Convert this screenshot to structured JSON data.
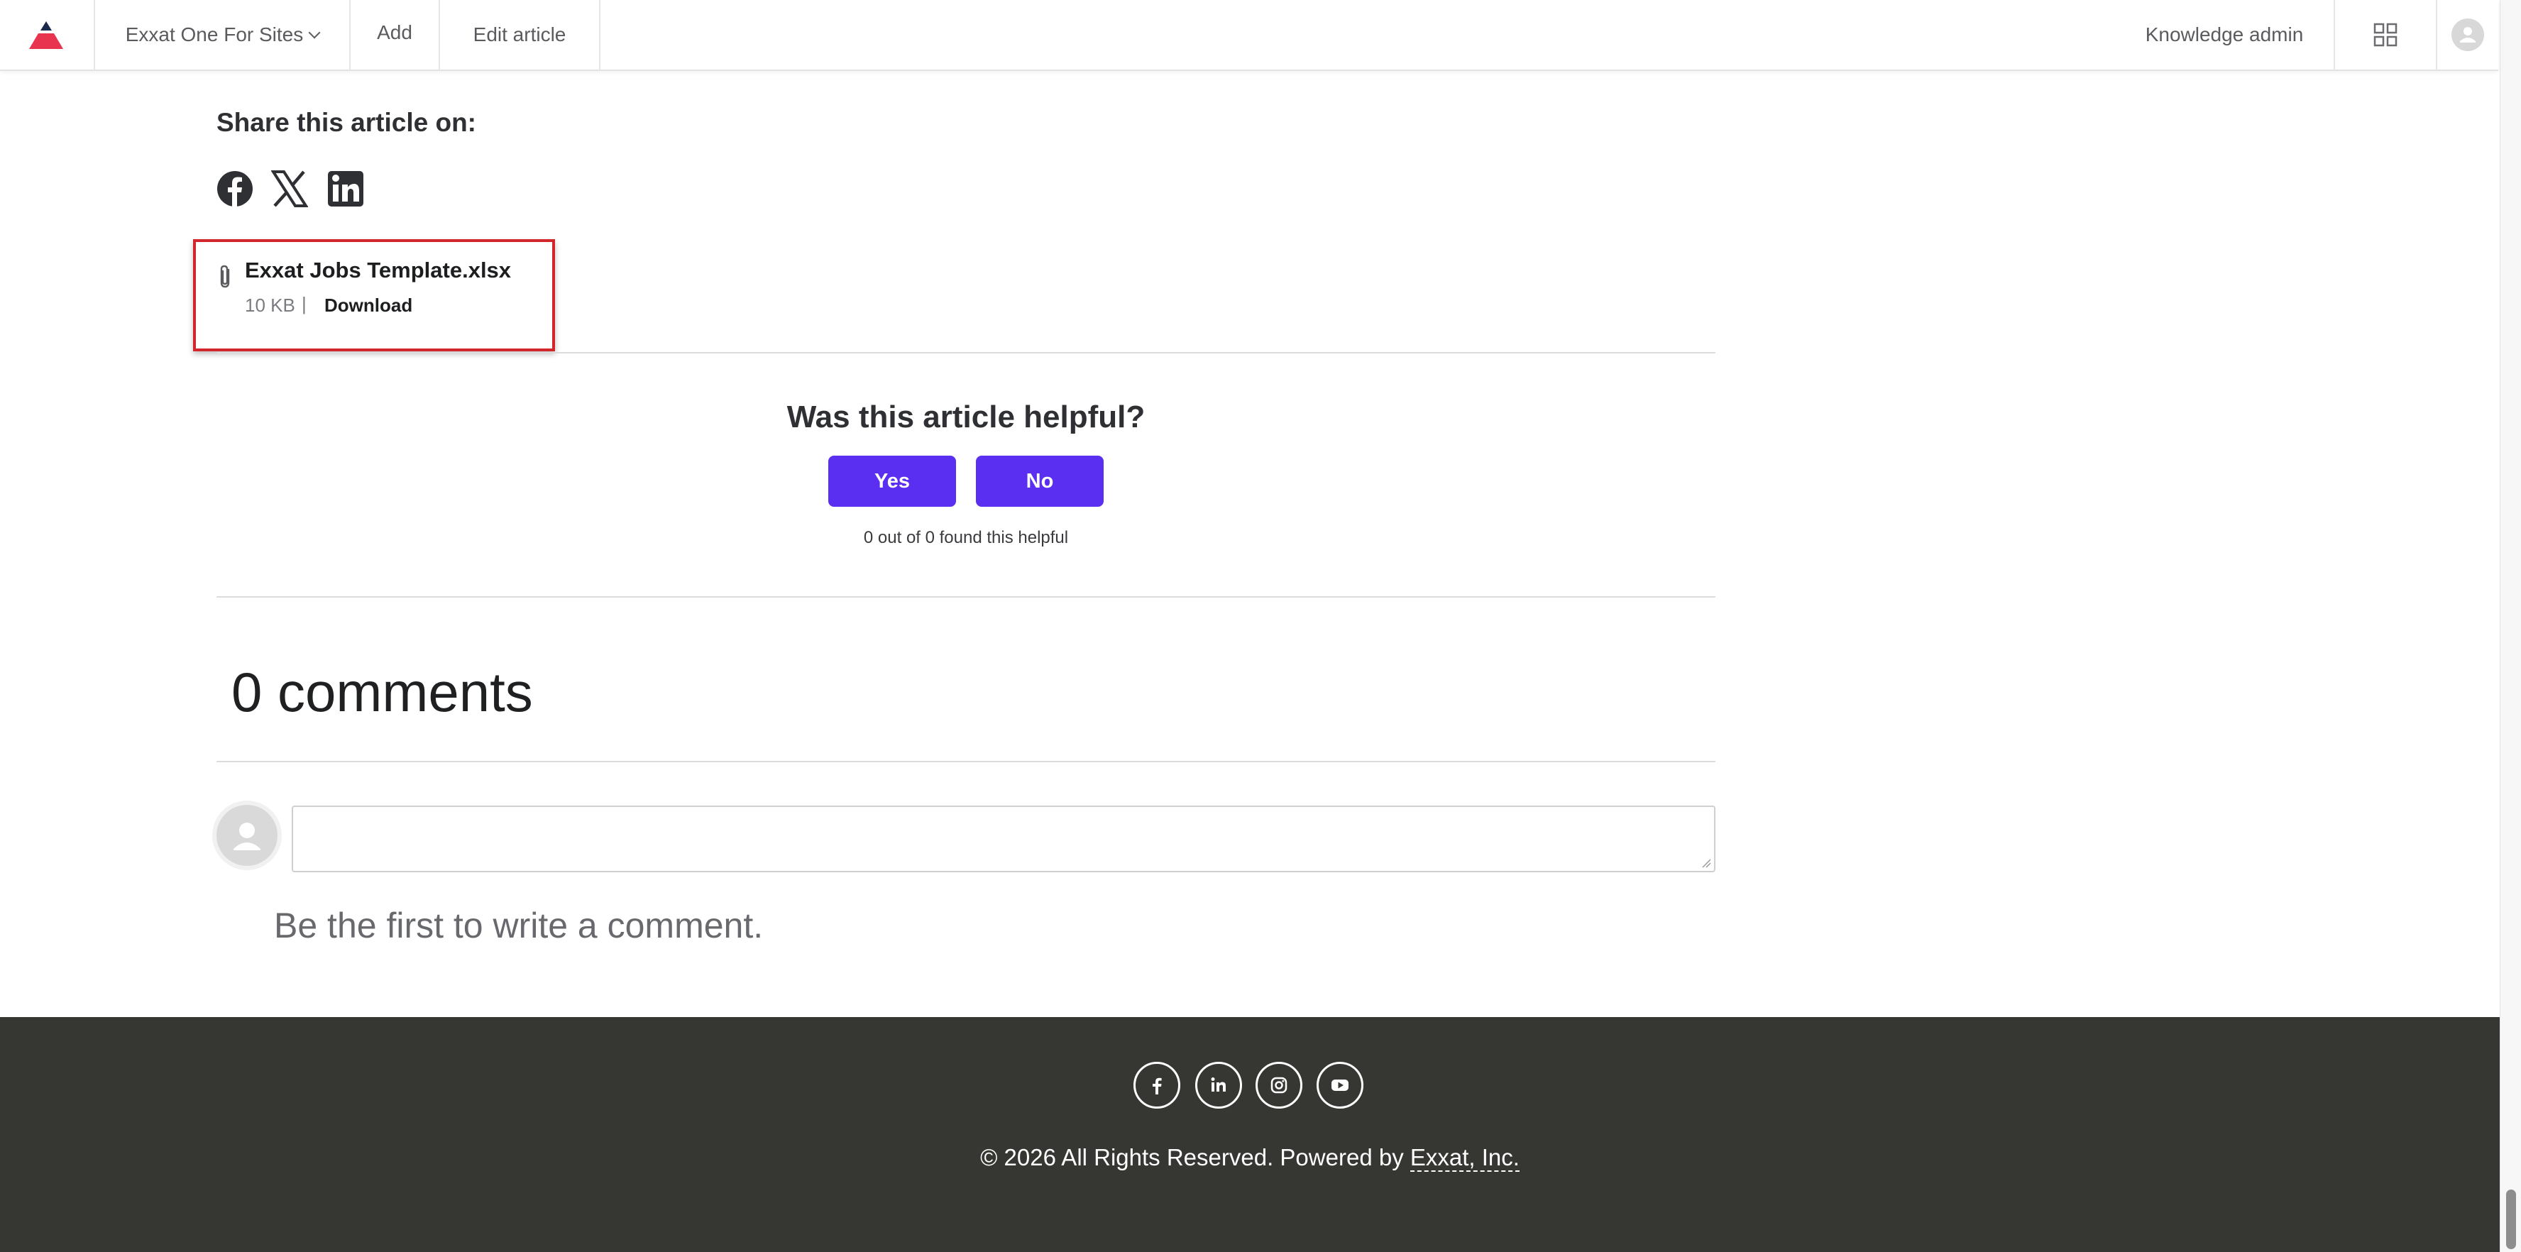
{
  "topbar": {
    "site_selector": "Exxat One For Sites",
    "add": "Add",
    "edit_article": "Edit article",
    "knowledge_admin": "Knowledge admin"
  },
  "article": {
    "share_title": "Share this article on:",
    "share_icons": [
      "facebook-icon",
      "x-twitter-icon",
      "linkedin-icon"
    ],
    "attachment": {
      "file_name": "Exxat Jobs Template.xlsx",
      "size": "10 KB",
      "separator": "|",
      "download": "Download"
    },
    "helpful": {
      "question": "Was this article helpful?",
      "yes": "Yes",
      "no": "No",
      "count_text": "0 out of 0 found this helpful"
    }
  },
  "comments": {
    "title": "0 comments",
    "input_value": "",
    "empty_text": "Be the first to write a comment."
  },
  "footer": {
    "social_icons": [
      "facebook-icon",
      "linkedin-icon",
      "instagram-icon",
      "youtube-icon"
    ],
    "copyright_prefix": "© 2026 All Rights Reserved. Powered by",
    "company_link": "Exxat, Inc."
  },
  "colors": {
    "accent": "#5b2ff1",
    "footer_bg": "#363633",
    "highlight_border": "#d2262c",
    "logo_red": "#e8344e",
    "logo_navy": "#1b2a4a"
  }
}
